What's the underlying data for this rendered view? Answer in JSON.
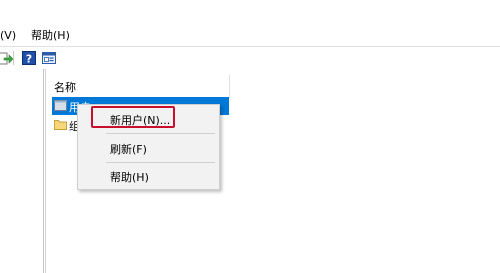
{
  "menubar": {
    "view": "(V)",
    "help": "帮助(H)"
  },
  "list": {
    "column_name": "名称",
    "rows": [
      {
        "label": "用户"
      },
      {
        "label": "组"
      }
    ]
  },
  "context_menu": {
    "items": [
      {
        "label": "新用户(N)..."
      },
      {
        "label": "刷新(F)"
      },
      {
        "label": "帮助(H)"
      }
    ]
  },
  "colors": {
    "selection": "#0078d7",
    "highlight_border": "#c8102e",
    "menu_bg": "#f2f2f2"
  },
  "toolbar": {
    "icons": [
      "export-icon",
      "help-icon",
      "properties-icon"
    ]
  }
}
